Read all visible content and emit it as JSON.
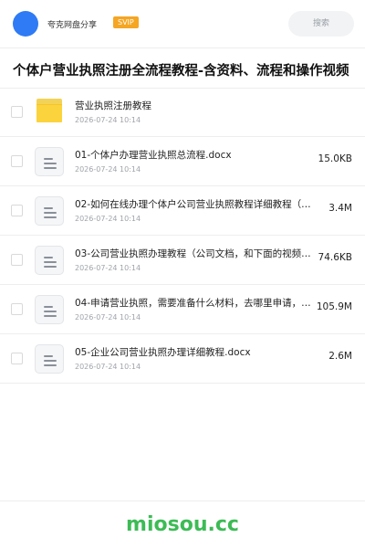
{
  "header": {
    "brand": "夸克网盘分享",
    "badge": "SVIP",
    "search_placeholder": "搜索",
    "avatar_color": "#2f7bf5",
    "badge_color": "#f5a623"
  },
  "share": {
    "title": "个体户营业执照注册全流程教程-含资料、流程和操作视频"
  },
  "files": [
    {
      "type": "folder",
      "icon": "folder-icon",
      "name": "营业执照注册教程",
      "date": "2026-07-24 10:14",
      "size": ""
    },
    {
      "type": "doc",
      "icon": "document-icon",
      "name": "01-个体户办理营业执照总流程.docx",
      "date": "2026-07-24 10:14",
      "size": "15.0KB"
    },
    {
      "type": "doc",
      "icon": "document-icon",
      "name": "02-如何在线办理个体户公司营业执照教程详细教程（…",
      "date": "2026-07-24 10:14",
      "size": "3.4M"
    },
    {
      "type": "doc",
      "icon": "document-icon",
      "name": "03-公司营业执照办理教程（公司文档，和下面的视频…",
      "date": "2026-07-24 10:14",
      "size": "74.6KB"
    },
    {
      "type": "doc",
      "icon": "document-icon",
      "name": "04-申请营业执照，需要准备什么材料，去哪里申请，…",
      "date": "2026-07-24 10:14",
      "size": "105.9M"
    },
    {
      "type": "doc",
      "icon": "document-icon",
      "name": "05-企业公司营业执照办理详细教程.docx",
      "date": "2026-07-24 10:14",
      "size": "2.6M"
    }
  ],
  "watermark": {
    "text": "miosou.cc",
    "color": "#3dbb56"
  }
}
